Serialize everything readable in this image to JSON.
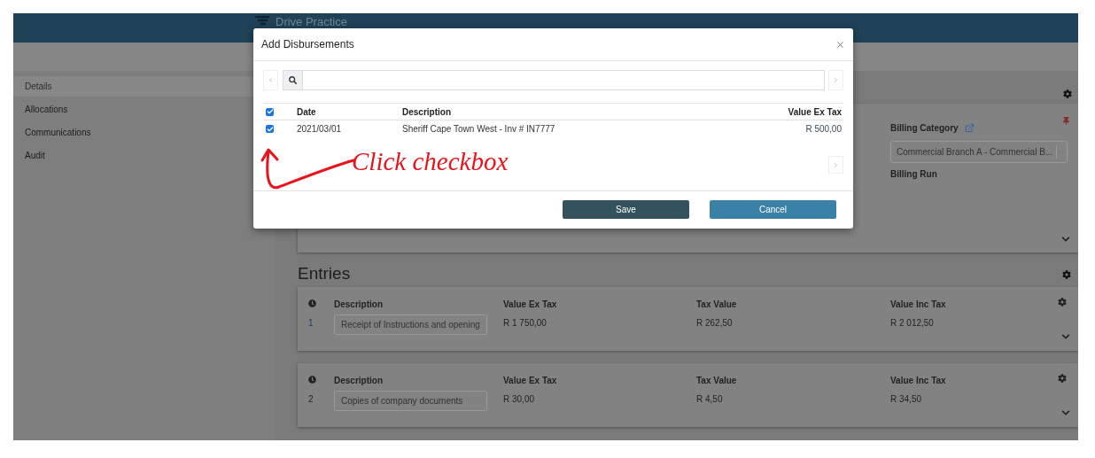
{
  "header": {
    "title": "Drive Practice"
  },
  "sidebar": {
    "items": [
      {
        "label": "Details",
        "selected": true
      },
      {
        "label": "Allocations",
        "selected": false
      },
      {
        "label": "Communications",
        "selected": false
      },
      {
        "label": "Audit",
        "selected": false
      }
    ]
  },
  "details_card": {
    "billing_category": {
      "label": "Billing Category",
      "value": "Commercial Branch A - Commercial B..."
    },
    "billing_run": {
      "label": "Billing Run"
    }
  },
  "entries": {
    "title": "Entries",
    "rows": [
      {
        "columns": [
          "Description",
          "Value Ex Tax",
          "Tax Value",
          "Value Inc Tax"
        ],
        "number": "1",
        "description": "Receipt of Instructions and opening",
        "value_ex_tax": "R 1 750,00",
        "tax_value": "R 262,50",
        "value_inc_tax": "R 2 012,50"
      },
      {
        "columns": [
          "Description",
          "Value Ex Tax",
          "Tax Value",
          "Value Inc Tax"
        ],
        "number": "2",
        "description": "Copies of company documents",
        "value_ex_tax": "R 30,00",
        "tax_value": "R 4,50",
        "value_inc_tax": "R 34,50"
      }
    ]
  },
  "modal": {
    "title": "Add Disbursements",
    "table": {
      "select_all_checked": true,
      "columns": [
        "Date",
        "Description",
        "Value Ex Tax"
      ],
      "rows": [
        {
          "checked": true,
          "date": "2021/03/01",
          "description": "Sheriff Cape Town West - Inv # IN7777",
          "value_ex_tax": "R 500,00"
        }
      ]
    },
    "buttons": [
      {
        "label": "Save",
        "kind": "primary"
      },
      {
        "label": "Cancel",
        "kind": "secondary"
      }
    ]
  },
  "annotation": {
    "text": "Click checkbox"
  }
}
